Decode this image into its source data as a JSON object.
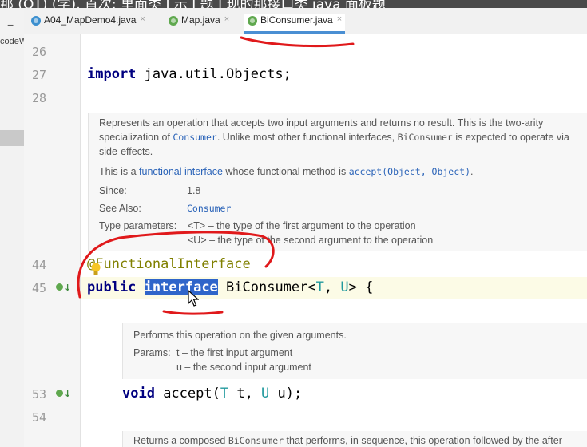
{
  "overlay": {
    "top_caption": "那 (OT) (学), 首次: 里面类 J 示 J 题 J 现的那接口类 java 面板题"
  },
  "left_pane": {
    "minus": "−",
    "partial_text": "codeW"
  },
  "tabs": [
    {
      "label": "A04_MapDemo4.java",
      "close": "×"
    },
    {
      "label": "Map.java",
      "close": "×"
    },
    {
      "label": "BiConsumer.java",
      "close": "×"
    }
  ],
  "gutter": {
    "lines": [
      "26",
      "27",
      "28",
      "44",
      "45",
      "53",
      "54"
    ]
  },
  "code": {
    "import_kw": "import",
    "import_rest": " java.util.Objects;",
    "annotation": "@FunctionalInterface",
    "decl_public": "public",
    "decl_interface": "interface",
    "decl_name": " BiConsumer<",
    "decl_t": "T",
    "decl_comma": ", ",
    "decl_u": "U",
    "decl_end": "> {",
    "accept_void": "void",
    "accept_name": " accept(",
    "accept_t": "T",
    "accept_mid": " t, ",
    "accept_u": "U",
    "accept_end": " u);"
  },
  "doc1": {
    "line1": "Represents an operation that accepts two input arguments and returns no result. This is the two-arity",
    "line2_a": "specialization of ",
    "line2_b": "Consumer",
    "line2_c": ". Unlike most other functional interfaces, ",
    "line2_d": "BiConsumer",
    "line2_e": " is expected to operate via",
    "line3": "side-effects.",
    "line4_a": "This is a ",
    "line4_b": "functional interface",
    "line4_c": " whose functional method is ",
    "line4_d": "accept(Object, Object)",
    "line4_e": ".",
    "since_label": "Since:",
    "since_value": "1.8",
    "see_label": "See Also:",
    "see_value": "Consumer",
    "tparams_label": "Type parameters:",
    "tparam1": "<T> – the type of the first argument to the operation",
    "tparam2": "<U> – the type of the second argument to the operation"
  },
  "doc2": {
    "line1": "Performs this operation on the given arguments.",
    "params_label": "Params:",
    "param1": "t – the first input argument",
    "param2": "u – the second input argument"
  },
  "doc3": {
    "line_a": "Returns a composed ",
    "line_b": "BiConsumer",
    "line_c": " that performs, in sequence, this operation followed by the after"
  },
  "colors": {
    "keyword": "#000080",
    "annotation": "#808000",
    "type_param": "#20999d",
    "selection": "#2f65ca",
    "ink": "#e0191b"
  },
  "icons": {
    "class_file": "c-circle-icon",
    "interface_file": "i-circle-icon",
    "implemented_marker": "implemented-arrow-icon",
    "bulb": "lightbulb-icon",
    "cursor": "mouse-pointer-icon"
  }
}
